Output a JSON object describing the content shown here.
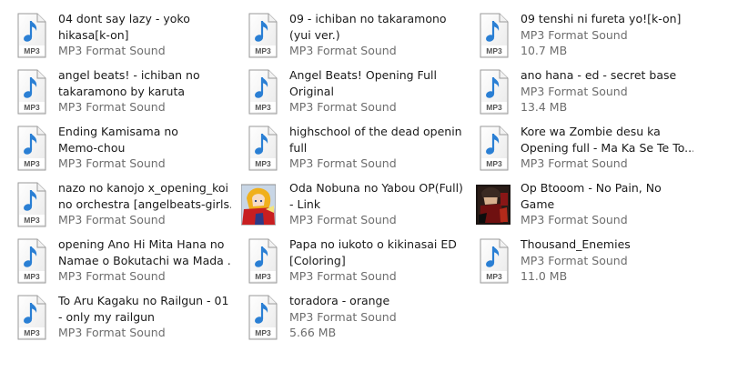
{
  "items": [
    {
      "name1": "04 dont say lazy - yoko",
      "name2": "hikasa[k-on]",
      "type": "MP3 Format Sound",
      "size": "",
      "thumbnail": "mp3-file-icon"
    },
    {
      "name1": "09 - ichiban no takaramono",
      "name2": "(yui ver.)",
      "type": "MP3 Format Sound",
      "size": "",
      "thumbnail": "mp3-file-icon"
    },
    {
      "name1": "09 tenshi ni fureta yo![k-on]",
      "name2": "",
      "type": "MP3 Format Sound",
      "size": "10.7 MB",
      "thumbnail": "mp3-file-icon"
    },
    {
      "name1": "angel beats! - ichiban no",
      "name2": "takaramono by karuta",
      "type": "MP3 Format Sound",
      "size": "",
      "thumbnail": "mp3-file-icon"
    },
    {
      "name1": "Angel Beats! Opening Full",
      "name2": "Original",
      "type": "MP3 Format Sound",
      "size": "",
      "thumbnail": "mp3-file-icon"
    },
    {
      "name1": "ano hana - ed - secret base",
      "name2": "",
      "type": "MP3 Format Sound",
      "size": "13.4 MB",
      "thumbnail": "mp3-file-icon"
    },
    {
      "name1": "Ending Kamisama no",
      "name2": "Memo-chou",
      "type": "MP3 Format Sound",
      "size": "",
      "thumbnail": "mp3-file-icon"
    },
    {
      "name1": "highschool of the dead opening",
      "name2": "full",
      "type": "MP3 Format Sound",
      "size": "",
      "thumbnail": "mp3-file-icon"
    },
    {
      "name1": "Kore wa Zombie desu ka",
      "name2": "Opening full - Ma Ka Se Te To...",
      "type": "MP3 Format Sound",
      "size": "",
      "thumbnail": "mp3-file-icon"
    },
    {
      "name1": "nazo no kanojo x_opening_koi",
      "name2": "no orchestra [angelbeats-girls...",
      "type": "MP3 Format Sound",
      "size": "",
      "thumbnail": "mp3-file-icon"
    },
    {
      "name1": "Oda Nobuna no Yabou OP(Full)",
      "name2": "- Link",
      "type": "MP3 Format Sound",
      "size": "",
      "thumbnail": "album-art-anime-girl"
    },
    {
      "name1": "Op Btooom - No Pain, No",
      "name2": "Game",
      "type": "MP3 Format Sound",
      "size": "",
      "thumbnail": "album-art-dark"
    },
    {
      "name1": "opening Ano Hi Mita Hana no",
      "name2": "Namae o Bokutachi wa Mada ...",
      "type": "MP3 Format Sound",
      "size": "",
      "thumbnail": "mp3-file-icon"
    },
    {
      "name1": "Papa no iukoto o kikinasai ED",
      "name2": "[Coloring]",
      "type": "MP3 Format Sound",
      "size": "",
      "thumbnail": "mp3-file-icon"
    },
    {
      "name1": "Thousand_Enemies",
      "name2": "",
      "type": "MP3 Format Sound",
      "size": "11.0 MB",
      "thumbnail": "mp3-file-icon"
    },
    {
      "name1": "To Aru Kagaku no Railgun - 01",
      "name2": "- only my railgun",
      "type": "MP3 Format Sound",
      "size": "",
      "thumbnail": "mp3-file-icon"
    },
    {
      "name1": "toradora - orange",
      "name2": "",
      "type": "MP3 Format Sound",
      "size": "5.66 MB",
      "thumbnail": "mp3-file-icon"
    }
  ],
  "icon_label": "MP3",
  "colors": {
    "note_blue": "#2a7fd4",
    "page_border": "#9a9a9a",
    "meta_text": "#6d6d6d"
  }
}
